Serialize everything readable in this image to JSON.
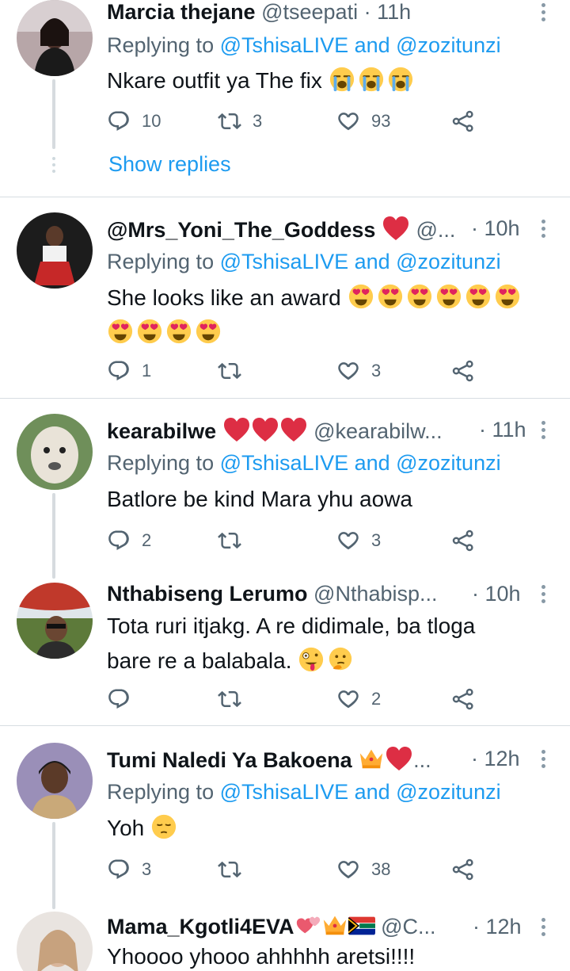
{
  "colors": {
    "accent": "#1d9bf0",
    "secondary_text": "#536471",
    "primary_text": "#0f1419",
    "like_red": "#e0245e",
    "divider": "#d7dde2"
  },
  "tweets": [
    {
      "name": "Marcia thejane",
      "handle": "@tseepati",
      "time": "· 11h",
      "reply_prefix": "Replying to",
      "reply_to": "@TshisaLIVE and @zozitunzi",
      "text": "Nkare outfit ya The fix",
      "emojis": [
        "loudly-crying-face",
        "loudly-crying-face",
        "loudly-crying-face"
      ],
      "replies": "10",
      "retweets": "3",
      "likes": "93",
      "show_replies": "Show replies"
    },
    {
      "name": "@Mrs_Yoni_The_Goddess",
      "handle": "@...",
      "time": "· 10h",
      "reply_prefix": "Replying to",
      "reply_to": "@TshisaLIVE and @zozitunzi",
      "text": "She looks like an award",
      "emojis": [
        "heart-eyes-face",
        "heart-eyes-face",
        "heart-eyes-face",
        "heart-eyes-face",
        "heart-eyes-face",
        "heart-eyes-face",
        "heart-eyes-face",
        "heart-eyes-face",
        "heart-eyes-face",
        "heart-eyes-face"
      ],
      "replies": "1",
      "retweets": "",
      "likes": "3"
    },
    {
      "name": "kearabilwe",
      "handle": "@kearabilw...",
      "time": "· 11h",
      "reply_prefix": "Replying to",
      "reply_to": "@TshisaLIVE and @zozitunzi",
      "text": "Batlore be kind Mara yhu aowa",
      "replies": "2",
      "retweets": "",
      "likes": "3"
    },
    {
      "name": "Nthabiseng Lerumo",
      "handle": "@Nthabisp...",
      "time": "· 10h",
      "text_line1": "Tota ruri itjakg. A re didimale, ba tloga",
      "text_line2": "bare re a balabala.",
      "emojis": [
        "zany-face",
        "thinking-face"
      ],
      "replies": "",
      "retweets": "",
      "likes": "2"
    },
    {
      "name": "Tumi Naledi Ya Bakoena",
      "handle": "...",
      "time": "· 12h",
      "reply_prefix": "Replying to",
      "reply_to": "@TshisaLIVE and @zozitunzi",
      "text": "Yoh",
      "emojis": [
        "pensive-face"
      ],
      "replies": "3",
      "retweets": "",
      "likes": "38"
    },
    {
      "name": "Mama_Kgotli4EVA",
      "handle": "@C...",
      "time": "· 12h",
      "text": "Yhoooo yhooo ahhhhh aretsi!!!!"
    }
  ]
}
